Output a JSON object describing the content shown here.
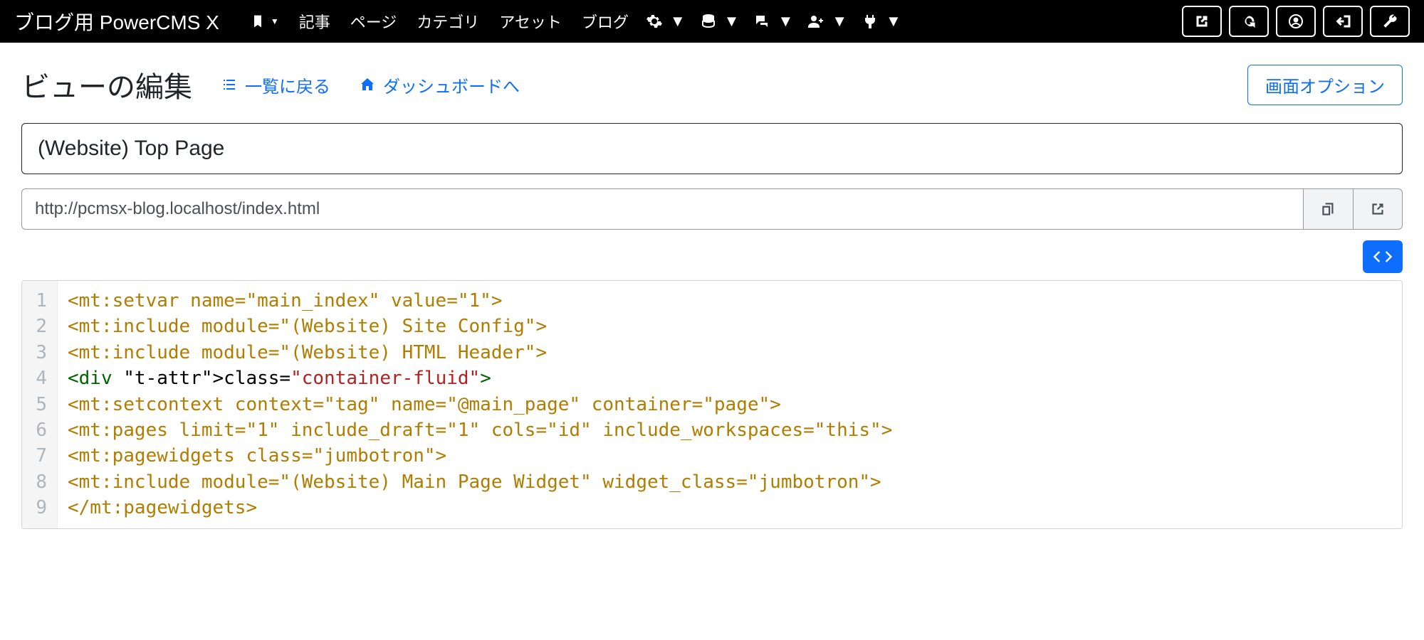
{
  "brand": "ブログ用 PowerCMS X",
  "nav": {
    "items": [
      "記事",
      "ページ",
      "カテゴリ",
      "アセット",
      "ブログ"
    ]
  },
  "page": {
    "title": "ビューの編集",
    "back_to_list": "一覧に戻る",
    "to_dashboard": "ダッシュボードへ",
    "screen_options": "画面オプション"
  },
  "form": {
    "name_value": "(Website) Top Page",
    "url_value": "http://pcmsx-blog.localhost/index.html"
  },
  "code_lines": [
    "<mt:setvar name=\"main_index\" value=\"1\">",
    "<mt:include module=\"(Website) Site Config\">",
    "<mt:include module=\"(Website) HTML Header\">",
    "<div class=\"container-fluid\">",
    "<mt:setcontext context=\"tag\" name=\"@main_page\" container=\"page\">",
    "<mt:pages limit=\"1\" include_draft=\"1\" cols=\"id\" include_workspaces=\"this\">",
    "<mt:pagewidgets class=\"jumbotron\">",
    "<mt:include module=\"(Website) Main Page Widget\" widget_class=\"jumbotron\">",
    "</mt:pagewidgets>"
  ]
}
